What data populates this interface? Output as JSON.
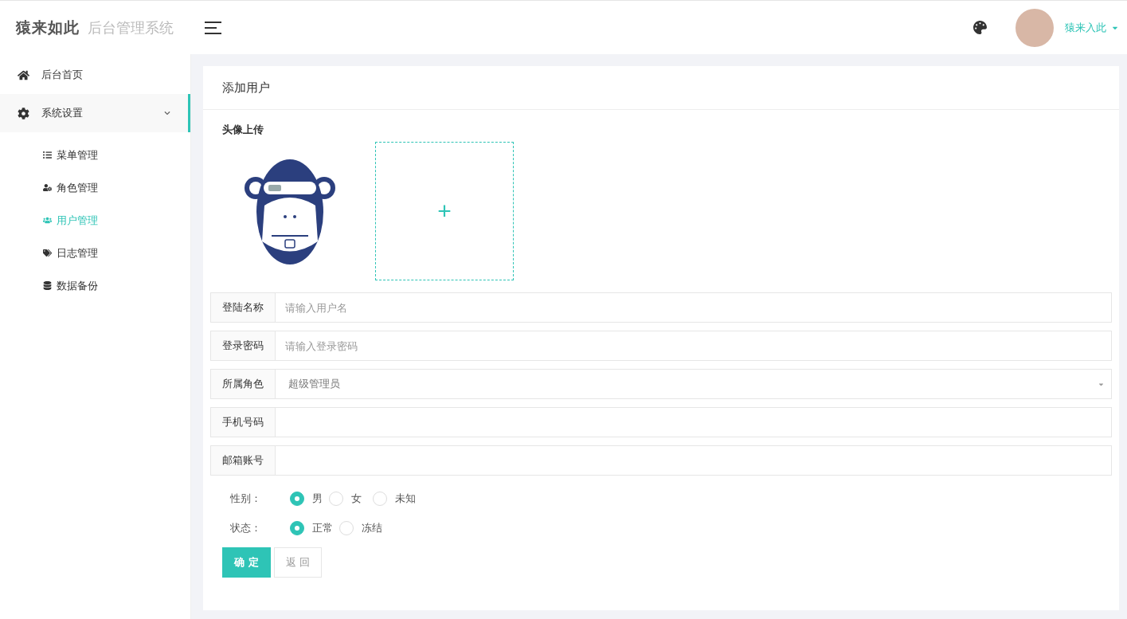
{
  "brand": {
    "logo": "猿来如此",
    "subtitle": "后台管理系统"
  },
  "header": {
    "user": "猿来入此"
  },
  "sidebar": {
    "items": [
      {
        "label": "后台首页",
        "selected": false
      },
      {
        "label": "系统设置",
        "selected": true,
        "expanded": true,
        "children": [
          {
            "label": "菜单管理",
            "selected": false
          },
          {
            "label": "角色管理",
            "selected": false
          },
          {
            "label": "用户管理",
            "selected": true
          },
          {
            "label": "日志管理",
            "selected": false
          },
          {
            "label": "数据备份",
            "selected": false
          }
        ]
      }
    ]
  },
  "card": {
    "title": "添加用户",
    "avatar_label": "头像上传",
    "upload_symbol": "+",
    "fields": [
      {
        "kind": "text",
        "label": "登陆名称",
        "placeholder": "请输入用户名"
      },
      {
        "kind": "text",
        "label": "登录密码",
        "placeholder": "请输入登录密码"
      },
      {
        "kind": "select",
        "label": "所属角色",
        "value": "超级管理员"
      },
      {
        "kind": "text",
        "label": "手机号码"
      },
      {
        "kind": "text",
        "label": "邮箱账号"
      }
    ],
    "radio_groups": [
      {
        "label": "性别：",
        "options": [
          {
            "label": "男",
            "selected": true
          },
          {
            "label": "女",
            "selected": false
          },
          {
            "label": "未知",
            "selected": false
          }
        ]
      },
      {
        "label": "状态：",
        "options": [
          {
            "label": "正常",
            "selected": true
          },
          {
            "label": "冻结",
            "selected": false
          }
        ]
      }
    ],
    "buttons": [
      {
        "kind": "primary",
        "label": "确 定"
      },
      {
        "kind": "default",
        "label": "返 回"
      }
    ]
  }
}
